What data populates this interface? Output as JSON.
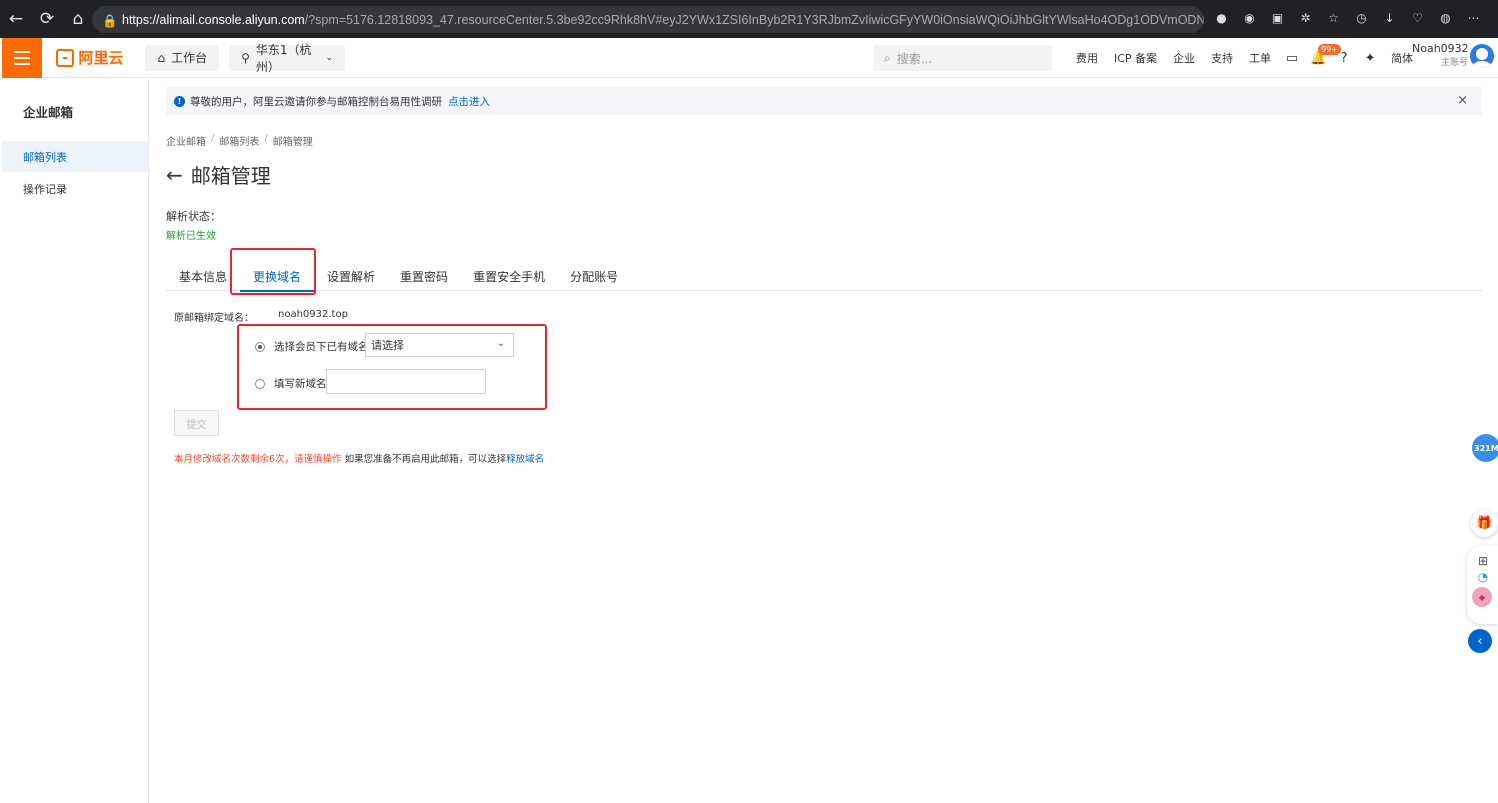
{
  "browser": {
    "url_host": "https://alimail.console.aliyun.com",
    "url_rest": "/?spm=5176.12818093_47.resourceCenter.5.3be92cc9Rhk8hV#eyJ2YWx1ZSI6InByb2R1Y3RJbmZvIiwicGFyYW0iOnsiaWQiOiJhbGltYWlsaHo4ODg1ODVmODNkNDg0ODdiYT..."
  },
  "topbar": {
    "brand": "阿里云",
    "workbench": "工作台",
    "region": "华东1（杭州）",
    "search_placeholder": "搜索...",
    "links": [
      "费用",
      "ICP 备案",
      "企业",
      "支持",
      "工单"
    ],
    "notification_badge": "99+",
    "language": "简体",
    "user_name": "Noah0932",
    "user_role": "主账号"
  },
  "sidebar": {
    "title": "企业邮箱",
    "items": [
      {
        "label": "邮箱列表",
        "active": true
      },
      {
        "label": "操作记录",
        "active": false
      }
    ]
  },
  "notice": {
    "text": "尊敬的用户，阿里云邀请你参与邮箱控制台易用性调研",
    "link": "点击进入"
  },
  "breadcrumb": [
    "企业邮箱",
    "邮箱列表",
    "邮箱管理"
  ],
  "page": {
    "title": "邮箱管理",
    "status_label": "解析状态：",
    "status_value": "解析已生效"
  },
  "tabs": [
    {
      "label": "基本信息",
      "active": false
    },
    {
      "label": "更换域名",
      "active": true
    },
    {
      "label": "设置解析",
      "active": false
    },
    {
      "label": "重置密码",
      "active": false
    },
    {
      "label": "重置安全手机",
      "active": false
    },
    {
      "label": "分配账号",
      "active": false
    }
  ],
  "form": {
    "original_domain_label": "原邮箱绑定域名：",
    "original_domain_value": "noah0932.top",
    "option_existing": "选择会员下已有域名",
    "select_value": "请选择",
    "option_new": "填写新域名",
    "new_domain_value": "",
    "submit": "提交"
  },
  "warning": {
    "red_text": "本月修改域名次数剩余6次，请谨慎操作",
    "black_text": " 如果您准备不再启用此邮箱，可以选择",
    "link": "释放域名"
  },
  "floating": {
    "badge": "321M"
  },
  "colors": {
    "brand_orange": "#ff6a00",
    "primary_blue": "#0064c8",
    "success_green": "#1d9e3a",
    "warning_red": "#f5482d",
    "annotation_red": "#e8262f"
  }
}
